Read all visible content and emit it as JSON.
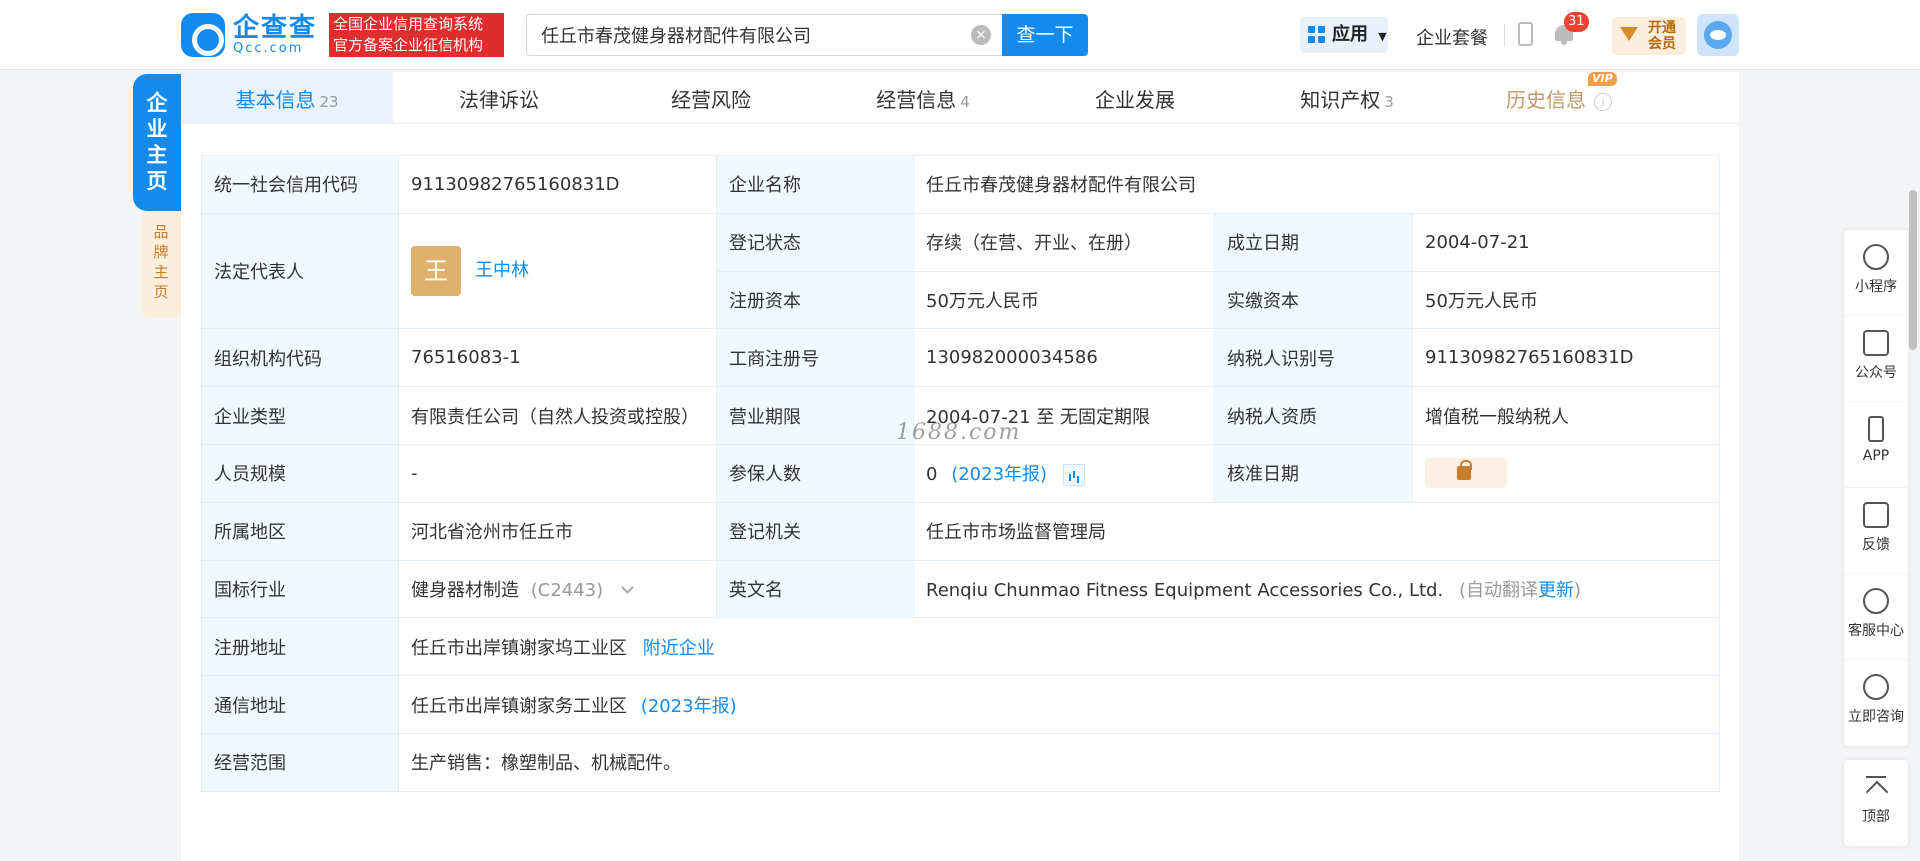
{
  "header": {
    "logo_cn": "企查查",
    "logo_en": "Qcc.com",
    "slogan_line1": "全国企业信用查询系统",
    "slogan_line2": "官方备案企业征信机构",
    "search_value": "任丘市春茂健身器材配件有限公司",
    "search_button": "查一下",
    "apps_label": "应用",
    "package_link": "企业套餐",
    "notification_count": "31",
    "vip_line1": "开通",
    "vip_line2": "会员"
  },
  "side_tabs": {
    "main": "企业主页",
    "brand": "品牌主页"
  },
  "tabs": [
    {
      "label": "基本信息",
      "count": "23"
    },
    {
      "label": "法律诉讼",
      "count": ""
    },
    {
      "label": "经营风险",
      "count": ""
    },
    {
      "label": "经营信息",
      "count": "4"
    },
    {
      "label": "企业发展",
      "count": ""
    },
    {
      "label": "知识产权",
      "count": "3"
    },
    {
      "label": "历史信息",
      "count": "",
      "badge": "VIP"
    }
  ],
  "info": {
    "credit_code_label": "统一社会信用代码",
    "credit_code": "91130982765160831D",
    "company_name_label": "企业名称",
    "company_name": "任丘市春茂健身器材配件有限公司",
    "legal_rep_label": "法定代表人",
    "legal_rep_avatar": "王",
    "legal_rep": "王中林",
    "reg_status_label": "登记状态",
    "reg_status": "存续（在营、开业、在册）",
    "founded_label": "成立日期",
    "founded": "2004-07-21",
    "reg_capital_label": "注册资本",
    "reg_capital": "50万元人民币",
    "paid_capital_label": "实缴资本",
    "paid_capital": "50万元人民币",
    "org_code_label": "组织机构代码",
    "org_code": "76516083-1",
    "biz_reg_no_label": "工商注册号",
    "biz_reg_no": "130982000034586",
    "taxpayer_id_label": "纳税人识别号",
    "taxpayer_id": "91130982765160831D",
    "company_type_label": "企业类型",
    "company_type": "有限责任公司（自然人投资或控股）",
    "biz_term_label": "营业期限",
    "biz_term": "2004-07-21 至 无固定期限",
    "taxpayer_qual_label": "纳税人资质",
    "taxpayer_qual": "增值税一般纳税人",
    "staff_size_label": "人员规模",
    "staff_size": "-",
    "insured_label": "参保人数",
    "insured": "0",
    "insured_note": "(2023年报)",
    "approved_label": "核准日期",
    "region_label": "所属地区",
    "region": "河北省沧州市任丘市",
    "authority_label": "登记机关",
    "authority": "任丘市市场监督管理局",
    "industry_label": "国标行业",
    "industry": "健身器材制造",
    "industry_code": "(C2443)",
    "en_name_label": "英文名",
    "en_name": "Renqiu Chunmao Fitness Equipment Accessories Co., Ltd.",
    "auto_translate": "(自动翻译",
    "update_link": "更新",
    "close_paren": ")",
    "reg_address_label": "注册地址",
    "reg_address": "任丘市出岸镇谢家坞工业区",
    "nearby_link": "附近企业",
    "mail_address_label": "通信地址",
    "mail_address": "任丘市出岸镇谢家务工业区",
    "mail_address_note": "(2023年报)",
    "scope_label": "经营范围",
    "scope": "生产销售：橡塑制品、机械配件。"
  },
  "watermark": "1688.com",
  "right_toolbar": [
    "小程序",
    "公众号",
    "APP",
    "反馈",
    "客服中心",
    "立即咨询",
    "顶部"
  ]
}
